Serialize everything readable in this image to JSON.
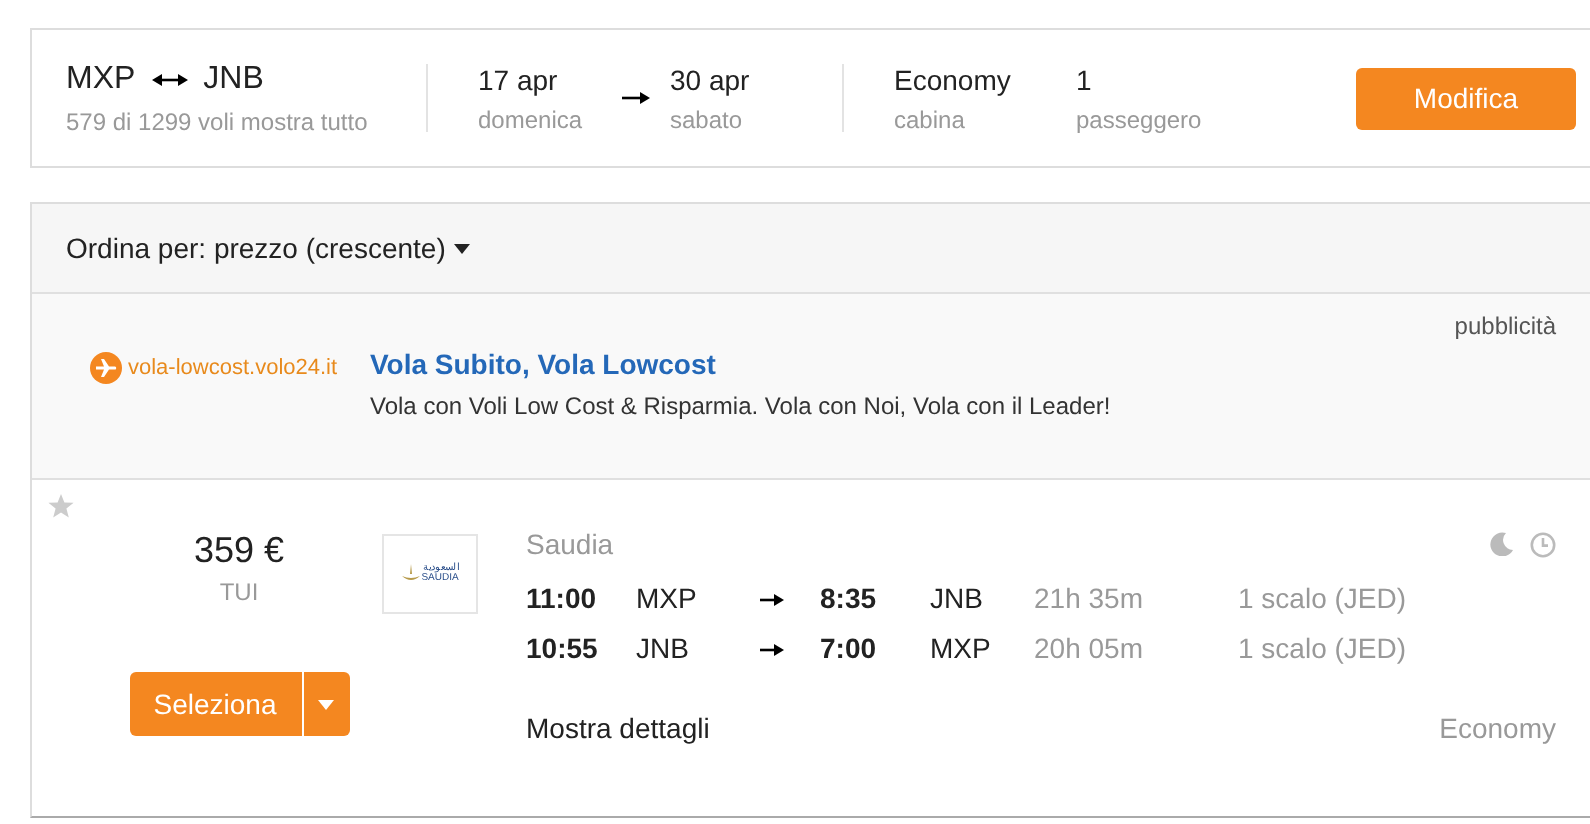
{
  "search": {
    "origin": "MXP",
    "destination": "JNB",
    "round_trip": true,
    "summary": "579 di 1299 voli mostra tutto",
    "depart": {
      "date": "17 apr",
      "weekday": "domenica"
    },
    "return": {
      "date": "30 apr",
      "weekday": "sabato"
    },
    "cabin": {
      "value": "Economy",
      "label": "cabina"
    },
    "passengers": {
      "value": "1",
      "label": "passeggero"
    },
    "button": "Modifica"
  },
  "sort": {
    "label": "Ordina per:",
    "value": "prezzo (crescente)"
  },
  "ad": {
    "site": "vola-lowcost.volo24.it",
    "title": "Vola Subito, Vola Lowcost",
    "text": "Vola con Voli Low Cost & Risparmia. Vola con Noi, Vola con il Leader!",
    "tag": "pubblicità"
  },
  "results": [
    {
      "favorite": false,
      "price": "359 €",
      "provider": "TUI",
      "button": "Seleziona",
      "logo": {
        "arabic": "السعودية",
        "latin": "SAUDIA"
      },
      "airline": "Saudia",
      "overnight": true,
      "legs": [
        {
          "depart_time": "11:00",
          "from": "MXP",
          "arrive_time": "8:35",
          "to": "JNB",
          "duration": "21h 35m",
          "stops": "1 scalo (JED)"
        },
        {
          "depart_time": "10:55",
          "from": "JNB",
          "arrive_time": "7:00",
          "to": "MXP",
          "duration": "20h 05m",
          "stops": "1 scalo (JED)"
        }
      ],
      "details": "Mostra dettagli",
      "cabin": "Economy"
    }
  ]
}
